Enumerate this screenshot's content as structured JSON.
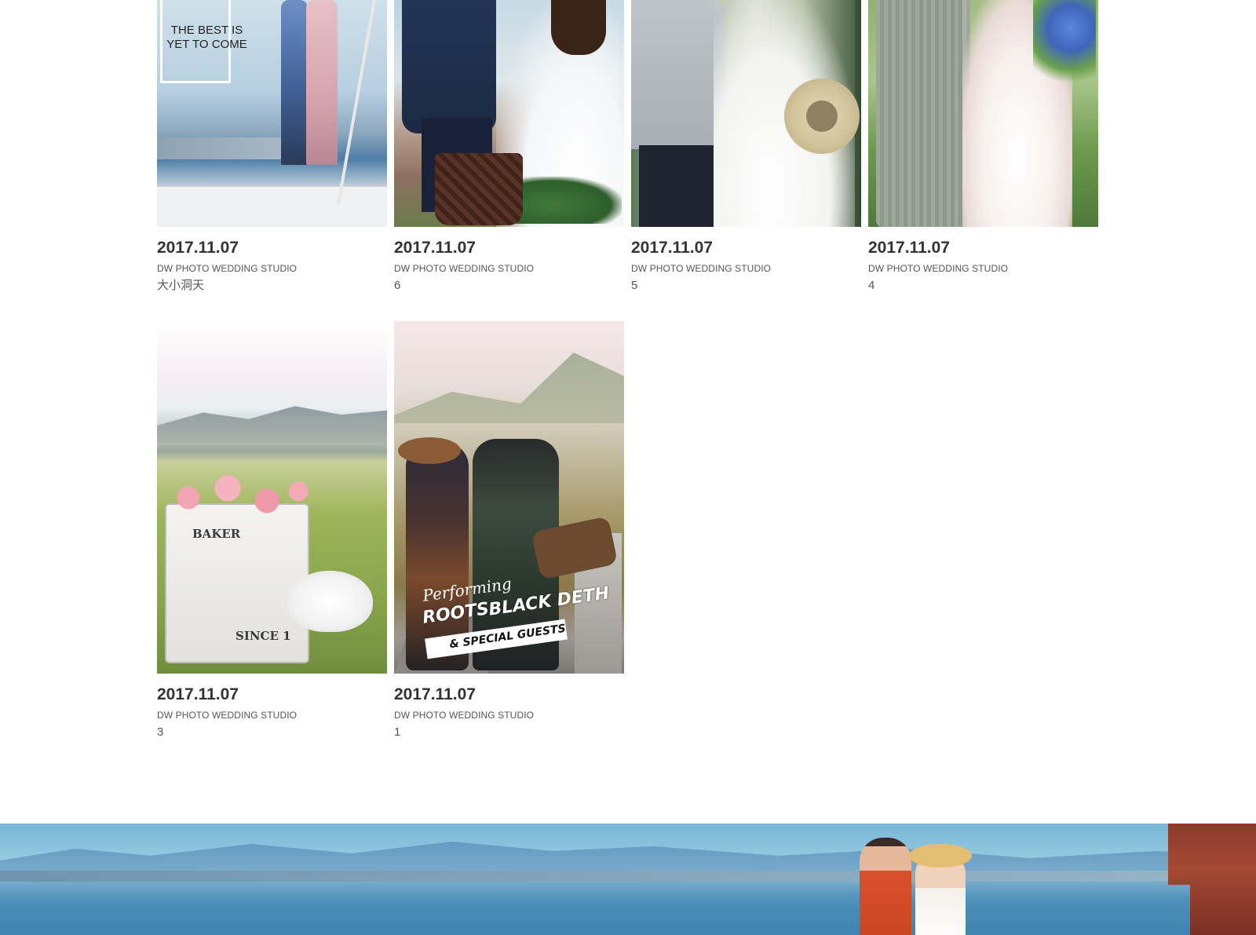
{
  "gallery": {
    "items": [
      {
        "date": "2017.11.07",
        "studio": "DW PHOTO WEDDING STUDIO",
        "caption": "大小洞天",
        "photo_text": "THE BEST IS YET TO COME"
      },
      {
        "date": "2017.11.07",
        "studio": "DW PHOTO WEDDING STUDIO",
        "caption": "6"
      },
      {
        "date": "2017.11.07",
        "studio": "DW PHOTO WEDDING STUDIO",
        "caption": "5"
      },
      {
        "date": "2017.11.07",
        "studio": "DW PHOTO WEDDING STUDIO",
        "caption": "4"
      },
      {
        "date": "2017.11.07",
        "studio": "DW PHOTO WEDDING STUDIO",
        "caption": "3",
        "photo_text": [
          "BAKER",
          "SINCE 1"
        ]
      },
      {
        "date": "2017.11.07",
        "studio": "DW PHOTO WEDDING STUDIO",
        "caption": "1",
        "photo_text": [
          "Performing",
          "ROOTS",
          "BLACK DETH",
          "& SPECIAL GUESTS"
        ]
      }
    ]
  },
  "colors": {
    "background": "#ffffff",
    "date_text": "#333333",
    "meta_text": "#555555"
  }
}
